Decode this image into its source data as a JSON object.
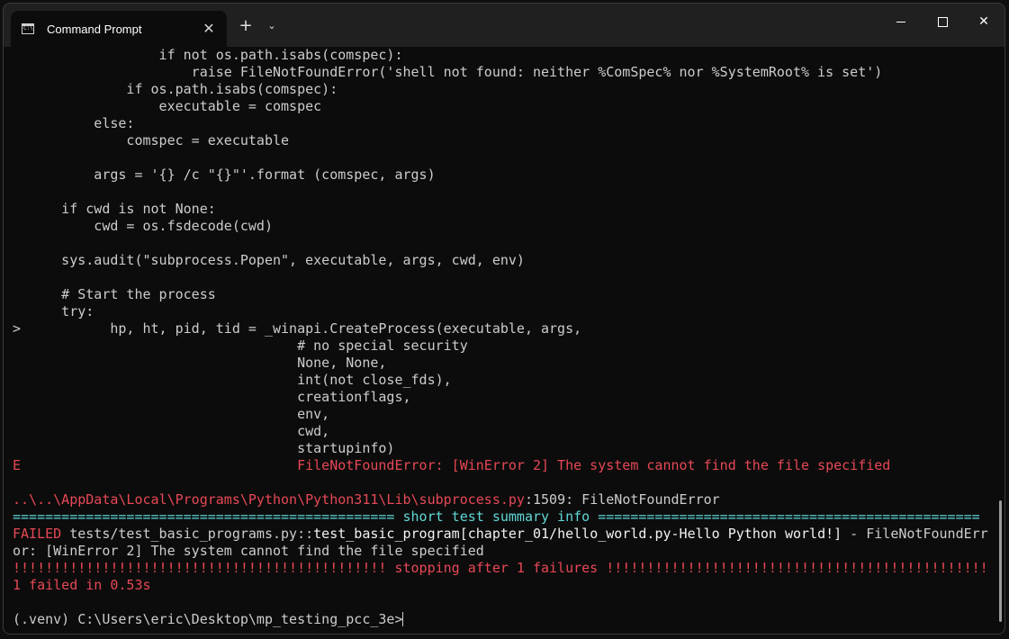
{
  "window": {
    "tab_title": "Command Prompt",
    "tab_icon": "cmd-icon",
    "tab_close_symbol": "✕",
    "new_tab_symbol": "+",
    "dropdown_symbol": "⌄",
    "close_symbol": "✕"
  },
  "colors": {
    "background": "#0c0c0c",
    "titlebar": "#202020",
    "text": "#cccccc",
    "error": "#e74856",
    "info": "#61d6d6"
  },
  "console_lines": [
    [
      {
        "t": "                  if not os.path.isabs(comspec):",
        "c": ""
      }
    ],
    [
      {
        "t": "                      raise FileNotFoundError('shell not found: neither %ComSpec% nor %SystemRoot% is set')",
        "c": ""
      }
    ],
    [
      {
        "t": "              if os.path.isabs(comspec):",
        "c": ""
      }
    ],
    [
      {
        "t": "                  executable = comspec",
        "c": ""
      }
    ],
    [
      {
        "t": "          else:",
        "c": ""
      }
    ],
    [
      {
        "t": "              comspec = executable",
        "c": ""
      }
    ],
    [
      {
        "t": "",
        "c": ""
      }
    ],
    [
      {
        "t": "          args = '{} /c \"{}\"'.format (comspec, args)",
        "c": ""
      }
    ],
    [
      {
        "t": "",
        "c": ""
      }
    ],
    [
      {
        "t": "      if cwd is not None:",
        "c": ""
      }
    ],
    [
      {
        "t": "          cwd = os.fsdecode(cwd)",
        "c": ""
      }
    ],
    [
      {
        "t": "",
        "c": ""
      }
    ],
    [
      {
        "t": "      sys.audit(\"subprocess.Popen\", executable, args, cwd, env)",
        "c": ""
      }
    ],
    [
      {
        "t": "",
        "c": ""
      }
    ],
    [
      {
        "t": "      # Start the process",
        "c": ""
      }
    ],
    [
      {
        "t": "      try:",
        "c": ""
      }
    ],
    [
      {
        "t": ">           hp, ht, pid, tid = _winapi.CreateProcess(executable, args,",
        "c": ""
      }
    ],
    [
      {
        "t": "                                   # no special security",
        "c": ""
      }
    ],
    [
      {
        "t": "                                   None, None,",
        "c": ""
      }
    ],
    [
      {
        "t": "                                   int(not close_fds),",
        "c": ""
      }
    ],
    [
      {
        "t": "                                   creationflags,",
        "c": ""
      }
    ],
    [
      {
        "t": "                                   env,",
        "c": ""
      }
    ],
    [
      {
        "t": "                                   cwd,",
        "c": ""
      }
    ],
    [
      {
        "t": "                                   startupinfo)",
        "c": ""
      }
    ],
    [
      {
        "t": "E                                  FileNotFoundError: [WinError 2] The system cannot find the file specified",
        "c": "red"
      }
    ],
    [
      {
        "t": "",
        "c": ""
      }
    ],
    [
      {
        "t": "..\\..\\AppData\\Local\\Programs\\Python\\Python311\\Lib\\subprocess.py",
        "c": "red"
      },
      {
        "t": ":1509: FileNotFoundError",
        "c": ""
      }
    ],
    [
      {
        "t": "=============================================== short test summary info ===============================================",
        "c": "cyan"
      }
    ],
    [
      {
        "t": "FAILED",
        "c": "red"
      },
      {
        "t": " tests/test_basic_programs.py::",
        "c": ""
      },
      {
        "t": "test_basic_program[chapter_01/hello_world.py-Hello Python world!]",
        "c": "white"
      },
      {
        "t": " - FileNotFoundErr",
        "c": ""
      }
    ],
    [
      {
        "t": "or: [WinError 2] The system cannot find the file specified",
        "c": ""
      }
    ],
    [
      {
        "t": "!!!!!!!!!!!!!!!!!!!!!!!!!!!!!!!!!!!!!!!!!!!!!! stopping after 1 failures !!!!!!!!!!!!!!!!!!!!!!!!!!!!!!!!!!!!!!!!!!!!!!!",
        "c": "red"
      }
    ],
    [
      {
        "t": "1 failed",
        "c": "red"
      },
      {
        "t": " in 0.53s",
        "c": "red"
      }
    ],
    [
      {
        "t": "",
        "c": ""
      }
    ],
    [
      {
        "t": "(.venv) C:\\Users\\eric\\Desktop\\mp_testing_pcc_3e>",
        "c": ""
      }
    ]
  ]
}
